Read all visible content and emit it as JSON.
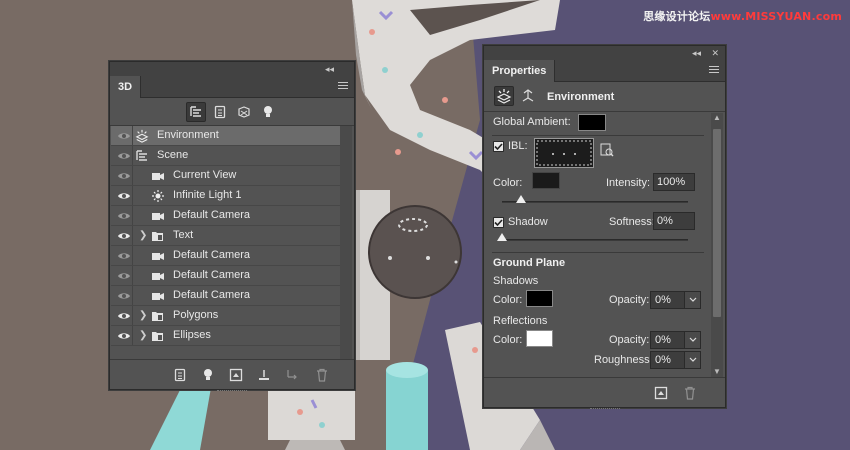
{
  "watermark": {
    "part1": "思缘设计论坛",
    "part2": "www.MISSYUAN.com"
  },
  "panel3d": {
    "tab": "3D",
    "collapse": "◂◂",
    "filters": [
      "whole-scene",
      "meshes",
      "materials",
      "lights"
    ],
    "layers": [
      {
        "label": "Environment",
        "icon": "environment-icon",
        "indent": 0,
        "selected": true,
        "eye_bright": false,
        "twist": false
      },
      {
        "label": "Scene",
        "icon": "scene-icon",
        "indent": 0,
        "selected": false,
        "eye_bright": false,
        "twist": false
      },
      {
        "label": "Current View",
        "icon": "camera-icon",
        "indent": 1,
        "selected": false,
        "eye_bright": false,
        "twist": false
      },
      {
        "label": "Infinite Light 1",
        "icon": "infinite-light-icon",
        "indent": 1,
        "selected": false,
        "eye_bright": true,
        "twist": false
      },
      {
        "label": "Default Camera",
        "icon": "camera-icon",
        "indent": 1,
        "selected": false,
        "eye_bright": false,
        "twist": false
      },
      {
        "label": "Text",
        "icon": "folder-mesh-icon",
        "indent": 1,
        "selected": false,
        "eye_bright": true,
        "twist": true
      },
      {
        "label": "Default Camera",
        "icon": "camera-icon",
        "indent": 1,
        "selected": false,
        "eye_bright": false,
        "twist": false
      },
      {
        "label": "Default Camera",
        "icon": "camera-icon",
        "indent": 1,
        "selected": false,
        "eye_bright": false,
        "twist": false
      },
      {
        "label": "Default Camera",
        "icon": "camera-icon",
        "indent": 1,
        "selected": false,
        "eye_bright": false,
        "twist": false
      },
      {
        "label": "Polygons",
        "icon": "folder-mesh-icon",
        "indent": 1,
        "selected": false,
        "eye_bright": true,
        "twist": true
      },
      {
        "label": "Ellipses",
        "icon": "folder-mesh-icon",
        "indent": 1,
        "selected": false,
        "eye_bright": true,
        "twist": true
      }
    ]
  },
  "props": {
    "tab": "Properties",
    "collapse": "◂◂",
    "close": "✕",
    "title": "Environment",
    "global_ambient_label": "Global Ambient:",
    "global_ambient_color": "#000000",
    "ibl_label": "IBL:",
    "ibl_checked": true,
    "color_label": "Color:",
    "ibl_color": "#1a1a1a",
    "intensity_label": "Intensity:",
    "intensity_value": "100%",
    "intensity_fraction": 0.1,
    "shadow_label": "Shadow",
    "shadow_checked": true,
    "softness_label": "Softness:",
    "softness_value": "0%",
    "softness_fraction": 0.0,
    "ground_plane_label": "Ground Plane",
    "shadows_label": "Shadows",
    "shadows_color_label": "Color:",
    "shadows_color": "#000000",
    "shadows_opacity_label": "Opacity:",
    "shadows_opacity_value": "0%",
    "reflections_label": "Reflections",
    "reflections_color_label": "Color:",
    "reflections_color": "#ffffff",
    "reflections_opacity_label": "Opacity:",
    "reflections_opacity_value": "0%",
    "roughness_label": "Roughness:",
    "roughness_value": "0%"
  }
}
